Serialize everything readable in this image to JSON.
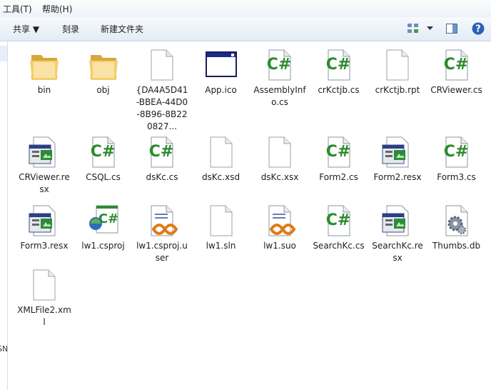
{
  "menu": {
    "tools": "工具(T)",
    "help": "帮助(H)"
  },
  "toolbar": {
    "share": "共享 ▼",
    "burn": "刻录",
    "new_folder": "新建文件夹"
  },
  "nav": {
    "cut_text": "SN"
  },
  "files": [
    {
      "name": "bin",
      "icon": "folder-icon"
    },
    {
      "name": "obj",
      "icon": "folder-icon"
    },
    {
      "name": "{DA4A5D41-BBEA-44D0-8B96-8B220827...",
      "icon": "blank-file-icon"
    },
    {
      "name": "App.ico",
      "icon": "window-icon"
    },
    {
      "name": "AssemblyInfo.cs",
      "icon": "csharp-file-icon"
    },
    {
      "name": "crKctjb.cs",
      "icon": "csharp-file-icon"
    },
    {
      "name": "crKctjb.rpt",
      "icon": "blank-file-icon"
    },
    {
      "name": "CRViewer.cs",
      "icon": "csharp-file-icon"
    },
    {
      "name": "CRViewer.resx",
      "icon": "resx-file-icon"
    },
    {
      "name": "CSQL.cs",
      "icon": "csharp-file-icon"
    },
    {
      "name": "dsKc.cs",
      "icon": "csharp-file-icon"
    },
    {
      "name": "dsKc.xsd",
      "icon": "blank-file-icon"
    },
    {
      "name": "dsKc.xsx",
      "icon": "blank-file-icon"
    },
    {
      "name": "Form2.cs",
      "icon": "csharp-file-icon"
    },
    {
      "name": "Form2.resx",
      "icon": "resx-file-icon"
    },
    {
      "name": "Form3.cs",
      "icon": "csharp-file-icon"
    },
    {
      "name": "Form3.resx",
      "icon": "resx-file-icon"
    },
    {
      "name": "lw1.csproj",
      "icon": "csproj-file-icon"
    },
    {
      "name": "lw1.csproj.user",
      "icon": "vs-file-icon"
    },
    {
      "name": "lw1.sln",
      "icon": "blank-file-icon"
    },
    {
      "name": "lw1.suo",
      "icon": "vs-file-icon"
    },
    {
      "name": "SearchKc.cs",
      "icon": "csharp-file-icon"
    },
    {
      "name": "SearchKc.resx",
      "icon": "resx-file-icon"
    },
    {
      "name": "Thumbs.db",
      "icon": "gear-file-icon"
    },
    {
      "name": "XMLFile2.xml",
      "icon": "blank-file-icon"
    }
  ]
}
